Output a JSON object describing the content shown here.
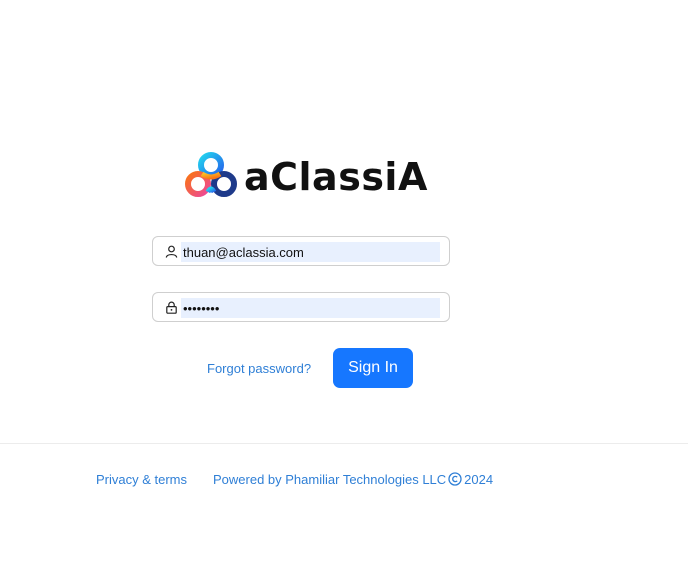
{
  "brand": {
    "name": "aClassiA",
    "logo_icon": "interlocking-rings-logo"
  },
  "login_form": {
    "username": {
      "icon": "user-icon",
      "value": "thuan@aclassia.com"
    },
    "password": {
      "icon": "lock-icon",
      "value": "........"
    },
    "forgot_password_label": "Forgot password?",
    "sign_in_label": "Sign In"
  },
  "footer": {
    "privacy_label": "Privacy & terms",
    "powered_by_label": "Powered by Phamiliar Technologies LLC",
    "copyright_icon": "copyright-icon",
    "year": "2024"
  },
  "colors": {
    "primary": "#1677ff",
    "link": "#2f7fd6",
    "autofill": "#e8f0fe",
    "text": "#111111"
  }
}
